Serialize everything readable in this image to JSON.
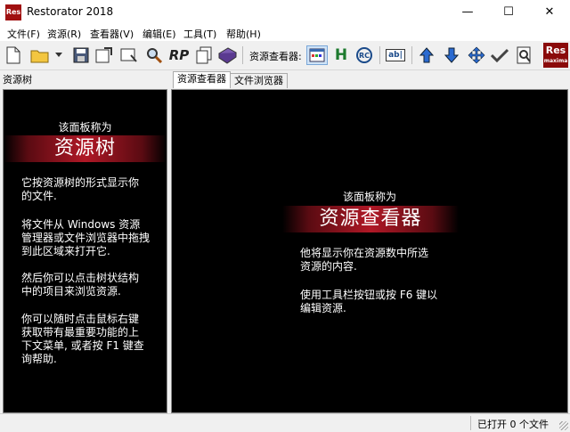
{
  "window": {
    "title": "Restorator 2018",
    "app_icon_text": "Res",
    "minimize": "—",
    "maximize": "☐",
    "close": "✕"
  },
  "menu": [
    "文件(F)",
    "资源(R)",
    "查看器(V)",
    "编辑(E)",
    "工具(T)",
    "帮助(H)"
  ],
  "toolbar": {
    "rp_label": "RP",
    "h_label": "H",
    "rc_label": "RC",
    "ab_label": "ab|",
    "viewer_label": "资源查看器:",
    "logo_text": "Res",
    "logo_sub": "maxima"
  },
  "left_pane": {
    "header": "资源树",
    "intro": "该面板称为",
    "title": "资源树",
    "paragraphs": [
      [
        "它按资源树的形式显示你",
        "的文件."
      ],
      [
        "将文件从 Windows 资源",
        "管理器或文件浏览器中拖拽",
        "到此区域来打开它."
      ],
      [
        "然后你可以点击树状结构",
        "中的项目来浏览资源."
      ],
      [
        "你可以随时点击鼠标右键",
        "获取带有最重要功能的上",
        "下文菜单, 或者按 F1 键查",
        "询帮助."
      ]
    ]
  },
  "tabs": [
    "资源查看器",
    "文件浏览器"
  ],
  "right_pane": {
    "intro": "该面板称为",
    "title": "资源查看器",
    "paragraphs": [
      [
        "他将显示你在资源数中所选",
        "资源的内容."
      ],
      [
        "使用工具栏按钮或按 F6 键以",
        "编辑资源."
      ]
    ]
  },
  "status": {
    "text": "已打开 0 个文件"
  }
}
